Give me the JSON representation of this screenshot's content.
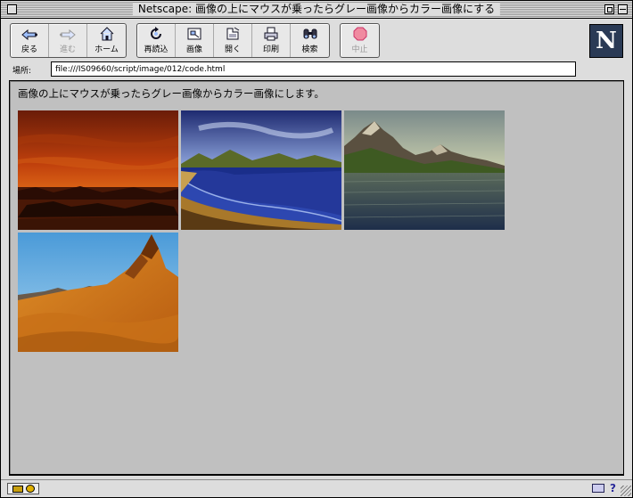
{
  "window": {
    "title": "Netscape: 画像の上にマウスが乗ったらグレー画像からカラー画像にする"
  },
  "toolbar": {
    "nav": [
      {
        "label": "戻る",
        "icon": "back-arrow-icon",
        "enabled": true
      },
      {
        "label": "進む",
        "icon": "forward-arrow-icon",
        "enabled": false
      },
      {
        "label": "ホーム",
        "icon": "home-icon",
        "enabled": true
      }
    ],
    "tools": [
      {
        "label": "再読込",
        "icon": "reload-icon"
      },
      {
        "label": "画像",
        "icon": "images-icon"
      },
      {
        "label": "開く",
        "icon": "open-icon"
      },
      {
        "label": "印刷",
        "icon": "print-icon"
      },
      {
        "label": "検索",
        "icon": "find-icon"
      }
    ],
    "stop": {
      "label": "中止",
      "icon": "stop-icon",
      "enabled": false
    },
    "logo": "N"
  },
  "location": {
    "label": "場所:",
    "url": "file:///IS09660/script/image/012/code.html"
  },
  "page": {
    "heading": "画像の上にマウスが乗ったらグレー画像からカラー画像にします。",
    "images": [
      {
        "name": "sunset-sea-image"
      },
      {
        "name": "bay-beach-image"
      },
      {
        "name": "mountain-lake-image"
      },
      {
        "name": "desert-peak-image"
      }
    ]
  },
  "colors": {
    "content_bg": "#c0c0c0",
    "chrome_bg": "#dddddd"
  }
}
